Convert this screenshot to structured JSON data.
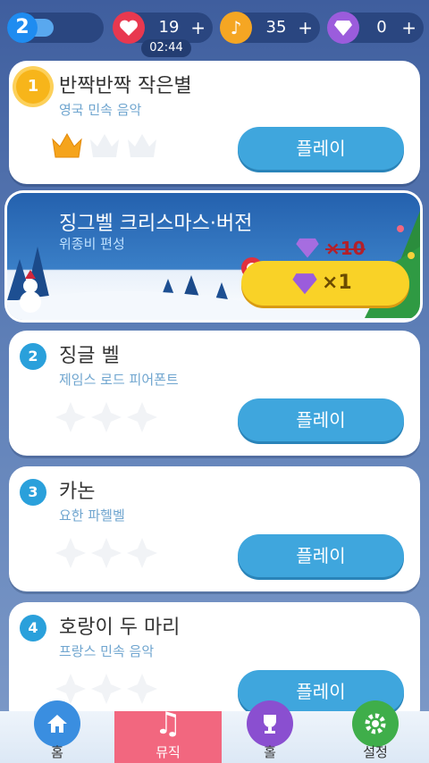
{
  "header": {
    "level": "2",
    "hearts": "19",
    "notes": "35",
    "gems": "0",
    "plus": "+",
    "timer": "02:44"
  },
  "songs": [
    {
      "rank": "1",
      "title": "반짝반짝 작은별",
      "subtitle": "영국 민속 음악",
      "play_label": "플레이",
      "crowns_earned": 1
    },
    {
      "rank": "2",
      "title": "징글 벨",
      "subtitle": "제임스 로드 피어폰트",
      "play_label": "플레이"
    },
    {
      "rank": "3",
      "title": "카논",
      "subtitle": "요한 파헬벨",
      "play_label": "플레이"
    },
    {
      "rank": "4",
      "title": "호랑이 두 마리",
      "subtitle": "프랑스 민속 음악",
      "play_label": "플레이"
    }
  ],
  "event": {
    "title": "징그벨 크리스마스·버전",
    "subtitle": "위종비 편성",
    "old_price": "×10",
    "price": "×1"
  },
  "nav": [
    {
      "label": "홈",
      "icon": "home-icon",
      "color": "#3a8ee0"
    },
    {
      "label": "뮤직",
      "icon": "music-note-icon",
      "color": "#f2677f"
    },
    {
      "label": "홀",
      "icon": "trophy-icon",
      "color": "#8a4fd0"
    },
    {
      "label": "설정",
      "icon": "gear-icon",
      "color": "#3fae4a"
    }
  ],
  "colors": {
    "accent": "#3fa6dd",
    "gold": "#f7b51a",
    "heart": "#e8384f",
    "note": "#f5a623",
    "gem": "#9b5cdc"
  }
}
